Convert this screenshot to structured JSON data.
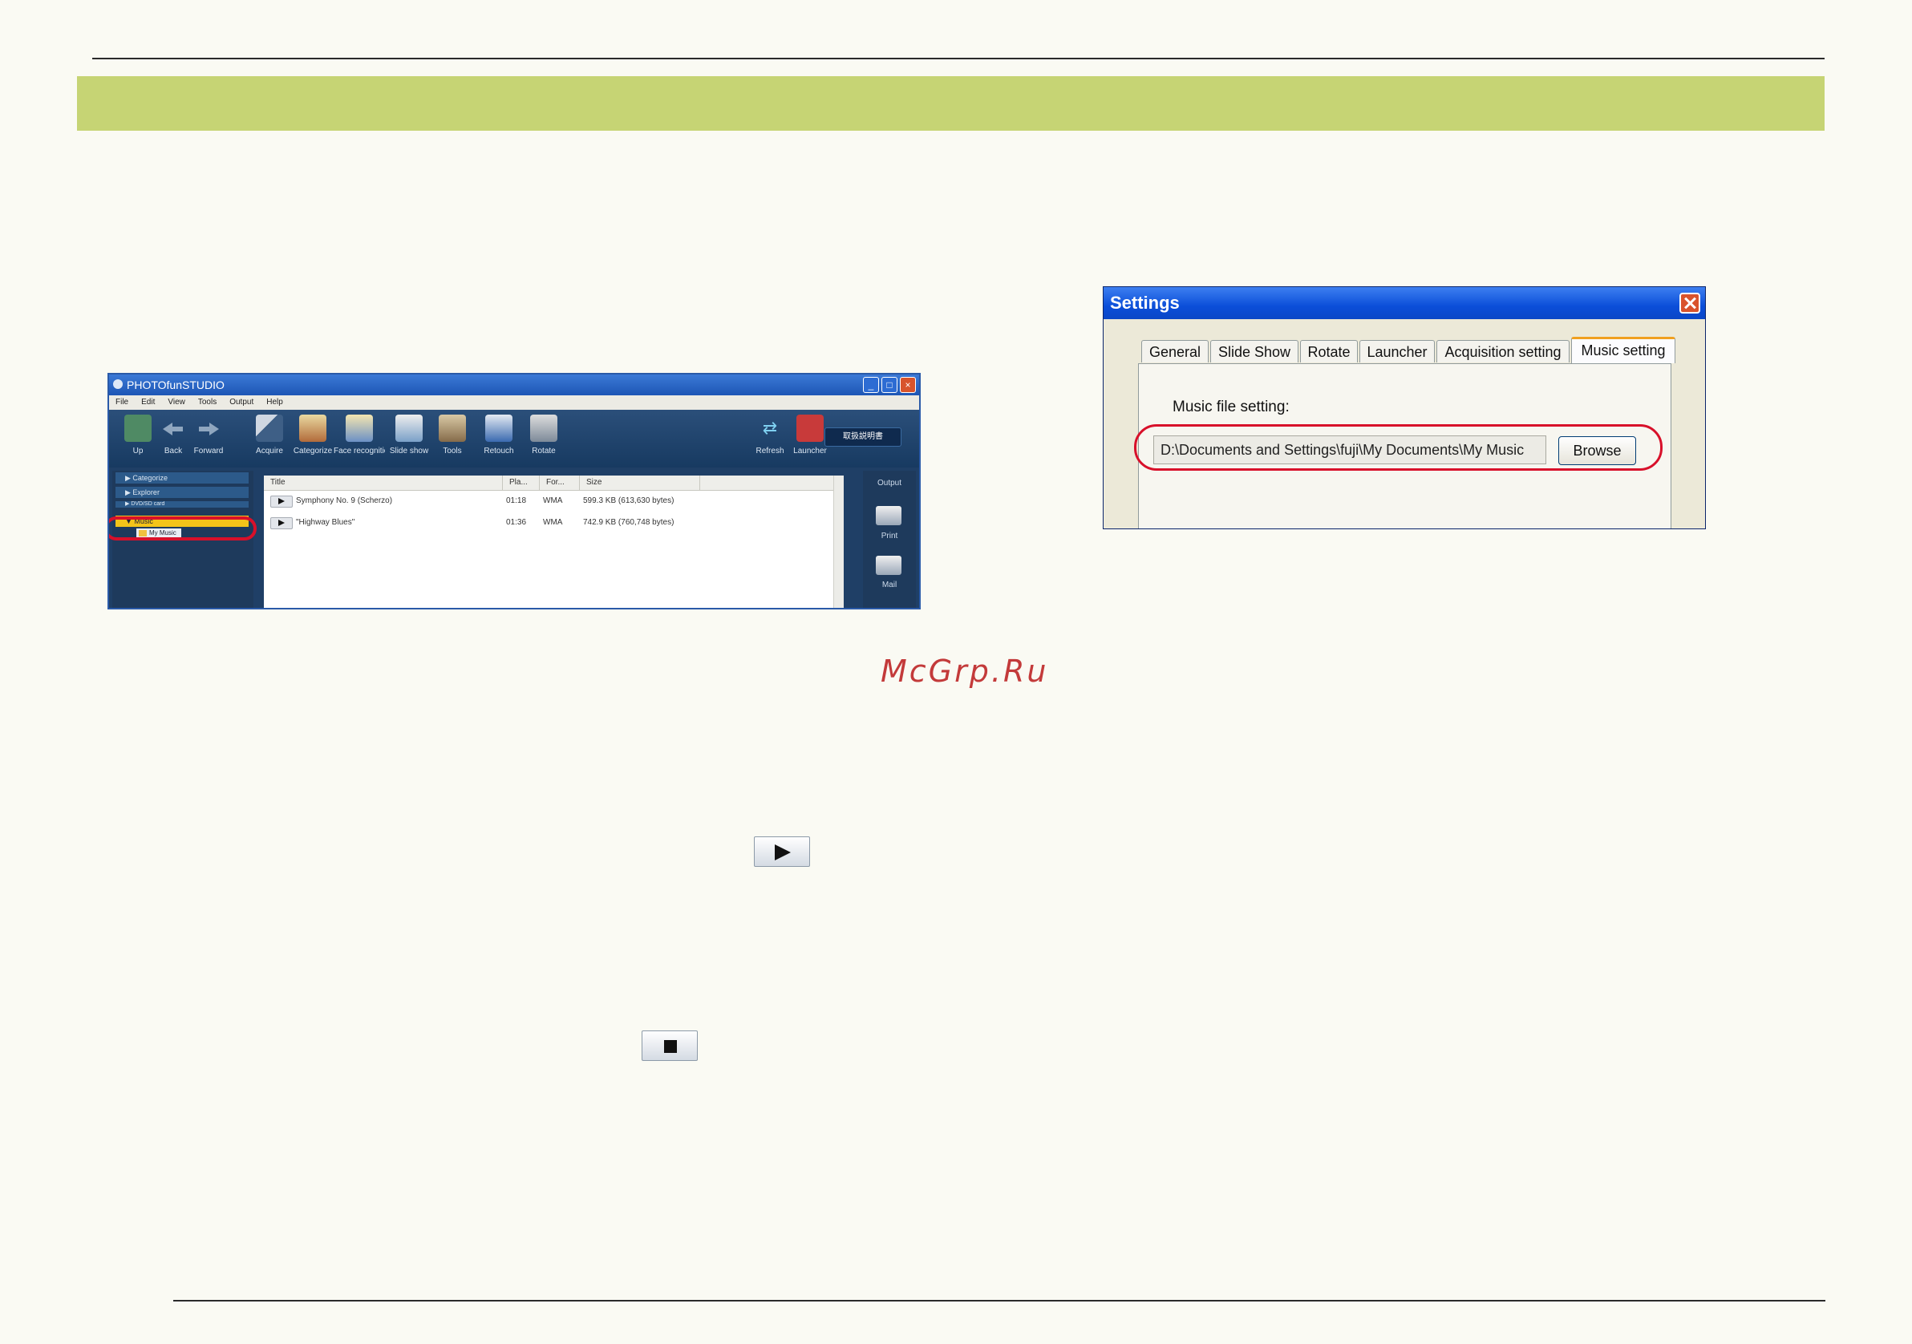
{
  "app": {
    "title": "PHOTOfunSTUDIO",
    "menu": [
      "File",
      "Edit",
      "View",
      "Tools",
      "Output",
      "Help"
    ],
    "toolbar": [
      {
        "label": "Up",
        "icon": "up-icon"
      },
      {
        "label": "Back",
        "icon": "back-arrow-icon"
      },
      {
        "label": "Forward",
        "icon": "forward-arrow-icon"
      },
      {
        "label": "Acquire",
        "icon": "acquire-icon"
      },
      {
        "label": "Categorize",
        "icon": "categorize-icon"
      },
      {
        "label": "Face recognition",
        "icon": "face-recognition-icon"
      },
      {
        "label": "Slide show",
        "icon": "slide-show-icon"
      },
      {
        "label": "Tools",
        "icon": "tools-icon"
      },
      {
        "label": "Retouch",
        "icon": "retouch-icon"
      },
      {
        "label": "Rotate",
        "icon": "rotate-icon"
      },
      {
        "label": "Refresh",
        "icon": "refresh-icon"
      },
      {
        "label": "Launcher",
        "icon": "launcher-icon"
      }
    ],
    "manual_button": "取扱説明書",
    "nav": {
      "categorize": "Categorize",
      "explorer": "Explorer",
      "dvd": "DVD/SD card",
      "music": "Music",
      "my_music": "My Music"
    },
    "columns": [
      "Title",
      "Pla...",
      "For...",
      "Size"
    ],
    "rows": [
      {
        "title": "Symphony No. 9 (Scherzo)",
        "play": "01:18",
        "format": "WMA",
        "size": "599.3 KB (613,630 bytes)"
      },
      {
        "title": "\"Highway Blues\"",
        "play": "01:36",
        "format": "WMA",
        "size": "742.9 KB (760,748 bytes)"
      }
    ],
    "output": {
      "header": "Output",
      "print": "Print",
      "mail": "Mail"
    }
  },
  "settings": {
    "title": "Settings",
    "tabs": [
      "General",
      "Slide Show",
      "Rotate",
      "Launcher",
      "Acquisition setting",
      "Music setting"
    ],
    "active_tab": "Music setting",
    "music_file_label": "Music file setting:",
    "path_value": "D:\\Documents and Settings\\fuji\\My Documents\\My Music",
    "browse_label": "Browse"
  },
  "watermark": "McGrp.Ru",
  "colors": {
    "banner": "#c6d474",
    "highlight": "#d8102a",
    "music_row": "#f3c419"
  }
}
